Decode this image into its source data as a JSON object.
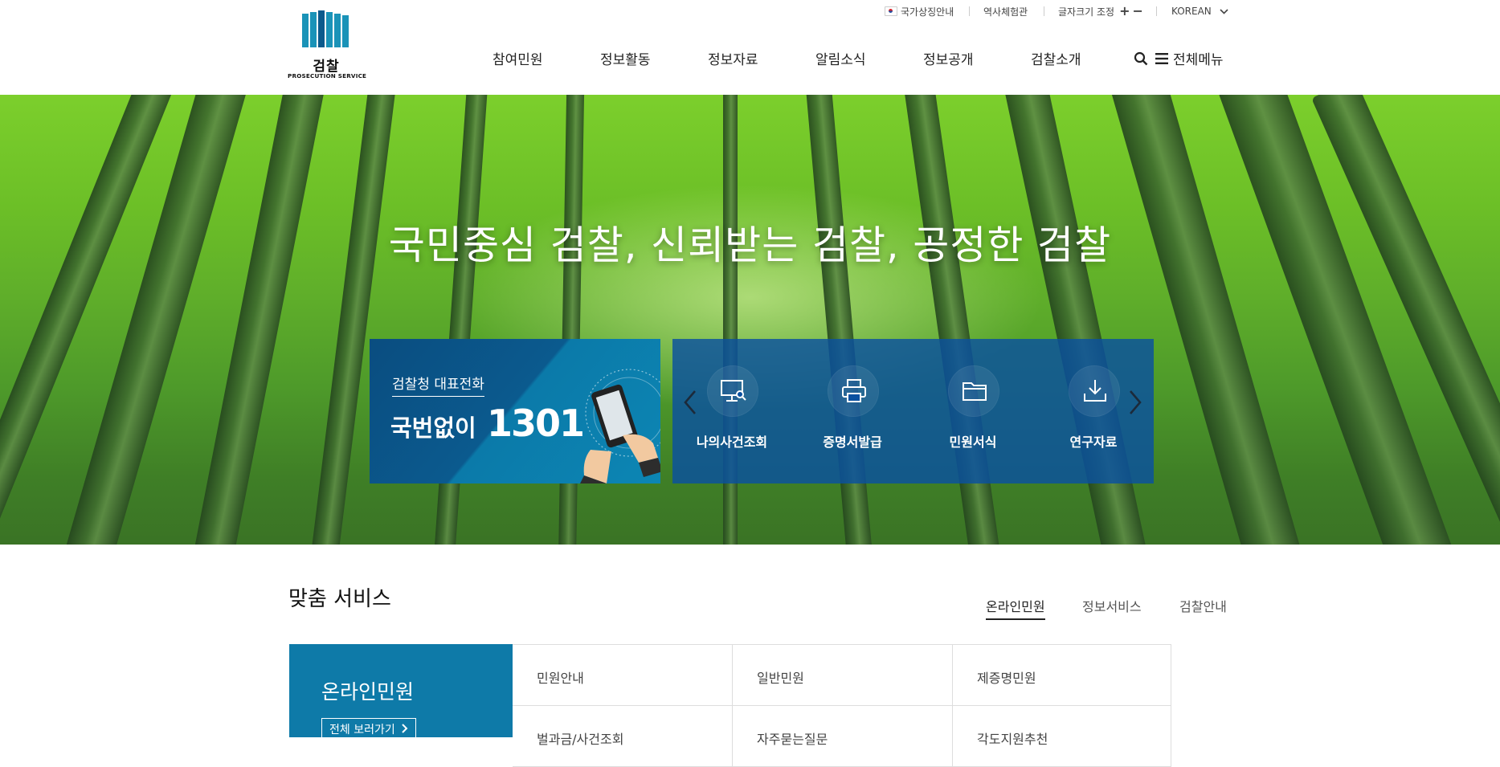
{
  "header": {
    "logo": {
      "title": "검찰",
      "subtitle": "PROSECUTION SERVICE",
      "colors": [
        "#1a93b8",
        "#0b5a8c"
      ]
    },
    "util": {
      "symbols": "국가상징안내",
      "history": "역사체험관",
      "font_size": "글자크기 조정",
      "plus": "+",
      "minus": "−",
      "language": "KOREAN"
    },
    "nav": [
      "참여민원",
      "정보활동",
      "정보자료",
      "알림소식",
      "정보공개",
      "검찰소개"
    ],
    "all_menu": "전체메뉴"
  },
  "hero": {
    "title": "국민중심 검찰, 신뢰받는 검찰, 공정한 검찰",
    "call": {
      "label": "검찰청 대표전화",
      "prefix": "국번없이",
      "number": "1301"
    },
    "quick_links": [
      {
        "label": "나의사건조회",
        "icon": "monitor-search-icon"
      },
      {
        "label": "증명서발급",
        "icon": "printer-icon"
      },
      {
        "label": "민원서식",
        "icon": "folder-icon"
      },
      {
        "label": "연구자료",
        "icon": "download-icon"
      }
    ]
  },
  "services": {
    "title": "맞춤 서비스",
    "tabs": [
      "온라인민원",
      "정보서비스",
      "검찰안내"
    ],
    "panel": {
      "title": "온라인민원",
      "view_all": "전체 보러가기"
    },
    "items": [
      "민원안내",
      "일반민원",
      "제증명민원",
      "벌과금/사건조회",
      "자주묻는질문",
      "각도지원추천"
    ]
  },
  "colors": {
    "primary": "#0e7aa8",
    "quick_bg": "#0a50a0",
    "accent_dark": "#0b4f83"
  }
}
